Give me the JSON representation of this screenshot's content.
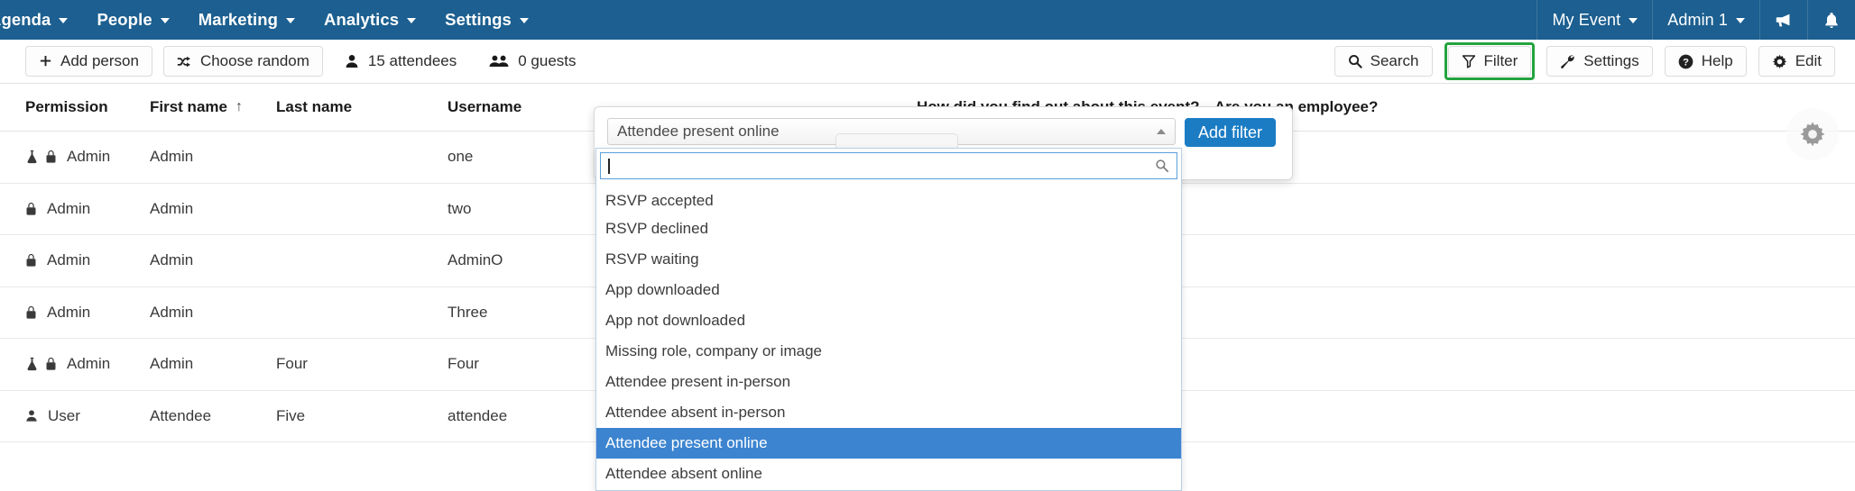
{
  "topnav": {
    "items": [
      {
        "label": "Agenda",
        "caret": true
      },
      {
        "label": "People",
        "caret": true
      },
      {
        "label": "Marketing",
        "caret": true
      },
      {
        "label": "Analytics",
        "caret": true
      },
      {
        "label": "Settings",
        "caret": true
      }
    ],
    "right": {
      "event_label": "My Event",
      "user_label": "Admin 1",
      "announce_icon": "megaphone-icon",
      "notifications_icon": "bell-icon"
    },
    "background_color": "#1c5f90"
  },
  "toolbar": {
    "left": [
      {
        "label": "Add person",
        "icon": "plus-icon"
      },
      {
        "label": "Choose random",
        "icon": "shuffle-icon"
      }
    ],
    "stats": [
      {
        "label": "15 attendees",
        "icon": "person-icon"
      },
      {
        "label": "0 guests",
        "icon": "people-icon"
      }
    ],
    "right": [
      {
        "label": "Search",
        "icon": "search-icon",
        "highlighted": false
      },
      {
        "label": "Filter",
        "icon": "funnel-icon",
        "highlighted": true
      },
      {
        "label": "Settings",
        "icon": "wrench-icon",
        "highlighted": false
      },
      {
        "label": "Help",
        "icon": "question-circle-icon",
        "highlighted": false
      },
      {
        "label": "Edit",
        "icon": "gear-icon",
        "highlighted": false
      }
    ],
    "highlight_color": "#24a33f"
  },
  "table": {
    "columns": [
      "Permission",
      "First name",
      "Last name",
      "Username",
      "How did you find out about this event?",
      "Are you an employee?"
    ],
    "sorted_column": "First name",
    "sort_arrow": "↑",
    "rows": [
      {
        "icons": [
          "flask-icon",
          "lock-icon"
        ],
        "permission": "Admin",
        "first_name": "Admin",
        "last_name": "",
        "username": "one",
        "how_did_you_find": "",
        "employee": ""
      },
      {
        "icons": [
          "lock-icon"
        ],
        "permission": "Admin",
        "first_name": "Admin",
        "last_name": "",
        "username": "two",
        "how_did_you_find": "",
        "employee": ""
      },
      {
        "icons": [
          "lock-icon"
        ],
        "permission": "Admin",
        "first_name": "Admin",
        "last_name": "",
        "username": "AdminO",
        "how_did_you_find": "",
        "employee": ""
      },
      {
        "icons": [
          "lock-icon"
        ],
        "permission": "Admin",
        "first_name": "Admin",
        "last_name": "",
        "username": "Three",
        "how_did_you_find": "",
        "employee": ""
      },
      {
        "icons": [
          "flask-icon",
          "lock-icon"
        ],
        "permission": "Admin",
        "first_name": "Admin",
        "last_name": "Four",
        "username": "Four",
        "how_did_you_find": "",
        "employee": ""
      },
      {
        "icons": [
          "person-icon"
        ],
        "permission": "User",
        "first_name": "Attendee",
        "last_name": "Five",
        "username": "attendee",
        "how_did_you_find": "",
        "employee": ""
      }
    ]
  },
  "filter_popover": {
    "select_value": "Attendee present online",
    "caret_icon": "caret-up-icon",
    "add_filter_label": "Add filter",
    "add_filter_color": "#1b7cc4"
  },
  "dropdown": {
    "search_value": "",
    "search_placeholder": "",
    "search_icon": "search-icon",
    "selected_option": "Attendee present online",
    "selected_color": "#3c84d0",
    "options": [
      "RSVP accepted",
      "RSVP declined",
      "RSVP waiting",
      "App downloaded",
      "App not downloaded",
      "Missing role, company or image",
      "Attendee present in-person",
      "Attendee absent in-person",
      "Attendee present online",
      "Attendee absent online"
    ]
  },
  "floating": {
    "gear_icon": "gear-icon"
  }
}
